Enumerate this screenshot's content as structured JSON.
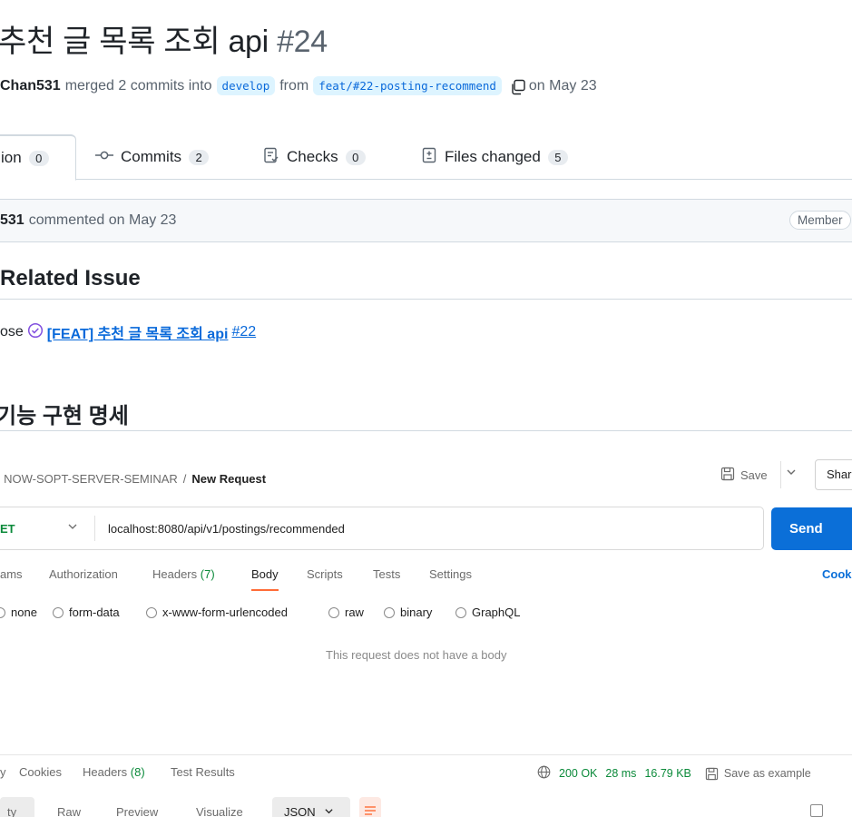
{
  "pr": {
    "title": "추천 글 목록 조회 api",
    "number": "#24",
    "author": "Chan531",
    "merge_text": "merged 2 commits into",
    "base_branch": "develop",
    "from_text": "from",
    "head_branch": "feat/#22-posting-recommend",
    "date_text": "on May 23"
  },
  "tabs": [
    {
      "label": "ion",
      "count": "0",
      "icon": ""
    },
    {
      "label": "Commits",
      "count": "2",
      "icon": "commit-icon"
    },
    {
      "label": "Checks",
      "count": "0",
      "icon": "checklist-icon"
    },
    {
      "label": "Files changed",
      "count": "5",
      "icon": "file-diff-icon"
    }
  ],
  "comment": {
    "author": "531",
    "action": "commented on May 23",
    "badge": "Member"
  },
  "body": {
    "related_heading": "Related Issue",
    "close_prefix": "ose",
    "issue_title": "[FEAT] 추천 글 목록 조회 api",
    "issue_number": "#22",
    "impl_heading": "기능 구현 명세"
  },
  "postman": {
    "collection": "NOW-SOPT-SERVER-SEMINAR",
    "separator": "/",
    "request_name": "New Request",
    "save_label": "Save",
    "share_label": "Shar",
    "method": "ET",
    "url": "localhost:8080/api/v1/postings/recommended",
    "send_label": "Send",
    "req_tabs": [
      {
        "label": "ams",
        "count": ""
      },
      {
        "label": "Authorization",
        "count": ""
      },
      {
        "label": "Headers",
        "count": "(7)"
      },
      {
        "label": "Body",
        "count": ""
      },
      {
        "label": "Scripts",
        "count": ""
      },
      {
        "label": "Tests",
        "count": ""
      },
      {
        "label": "Settings",
        "count": ""
      }
    ],
    "cookies_label": "Cook",
    "body_options": [
      "none",
      "form-data",
      "x-www-form-urlencoded",
      "raw",
      "binary",
      "GraphQL"
    ],
    "no_body_text": "This request does not have a body",
    "resp_tabs": [
      {
        "label": "y",
        "count": ""
      },
      {
        "label": "Cookies",
        "count": ""
      },
      {
        "label": "Headers",
        "count": "(8)"
      },
      {
        "label": "Test Results",
        "count": ""
      }
    ],
    "status": "200 OK",
    "time": "28 ms",
    "size": "16.79 KB",
    "save_example": "Save as example",
    "view_tabs": [
      "ty",
      "Raw",
      "Preview",
      "Visualize"
    ],
    "format": "JSON",
    "colors": {
      "orange": "#ff6c37",
      "blue": "#0b6fd8",
      "green": "#0b8a3a"
    }
  }
}
